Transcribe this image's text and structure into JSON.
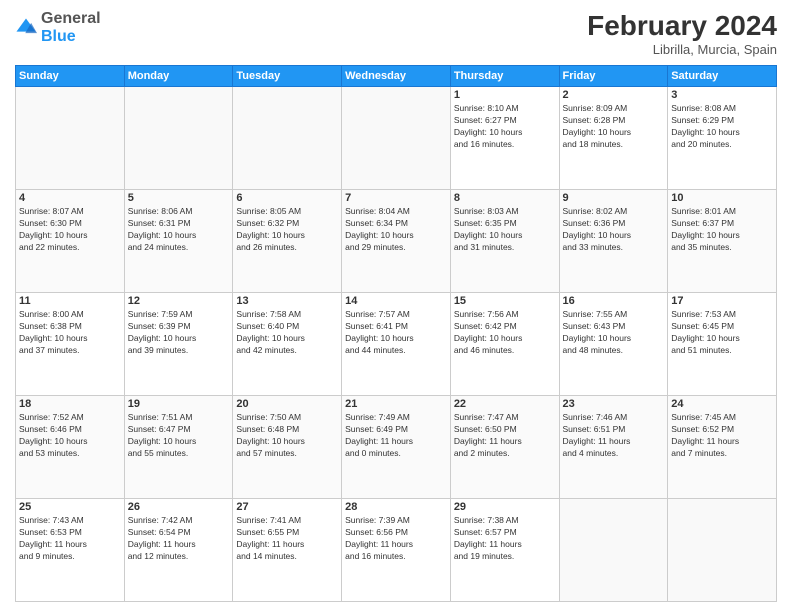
{
  "header": {
    "logo": {
      "general": "General",
      "blue": "Blue"
    },
    "title": "February 2024",
    "location": "Librilla, Murcia, Spain"
  },
  "calendar": {
    "days_of_week": [
      "Sunday",
      "Monday",
      "Tuesday",
      "Wednesday",
      "Thursday",
      "Friday",
      "Saturday"
    ],
    "weeks": [
      [
        {
          "day": "",
          "info": []
        },
        {
          "day": "",
          "info": []
        },
        {
          "day": "",
          "info": []
        },
        {
          "day": "",
          "info": []
        },
        {
          "day": "1",
          "info": [
            "Sunrise: 8:10 AM",
            "Sunset: 6:27 PM",
            "Daylight: 10 hours",
            "and 16 minutes."
          ]
        },
        {
          "day": "2",
          "info": [
            "Sunrise: 8:09 AM",
            "Sunset: 6:28 PM",
            "Daylight: 10 hours",
            "and 18 minutes."
          ]
        },
        {
          "day": "3",
          "info": [
            "Sunrise: 8:08 AM",
            "Sunset: 6:29 PM",
            "Daylight: 10 hours",
            "and 20 minutes."
          ]
        }
      ],
      [
        {
          "day": "4",
          "info": [
            "Sunrise: 8:07 AM",
            "Sunset: 6:30 PM",
            "Daylight: 10 hours",
            "and 22 minutes."
          ]
        },
        {
          "day": "5",
          "info": [
            "Sunrise: 8:06 AM",
            "Sunset: 6:31 PM",
            "Daylight: 10 hours",
            "and 24 minutes."
          ]
        },
        {
          "day": "6",
          "info": [
            "Sunrise: 8:05 AM",
            "Sunset: 6:32 PM",
            "Daylight: 10 hours",
            "and 26 minutes."
          ]
        },
        {
          "day": "7",
          "info": [
            "Sunrise: 8:04 AM",
            "Sunset: 6:34 PM",
            "Daylight: 10 hours",
            "and 29 minutes."
          ]
        },
        {
          "day": "8",
          "info": [
            "Sunrise: 8:03 AM",
            "Sunset: 6:35 PM",
            "Daylight: 10 hours",
            "and 31 minutes."
          ]
        },
        {
          "day": "9",
          "info": [
            "Sunrise: 8:02 AM",
            "Sunset: 6:36 PM",
            "Daylight: 10 hours",
            "and 33 minutes."
          ]
        },
        {
          "day": "10",
          "info": [
            "Sunrise: 8:01 AM",
            "Sunset: 6:37 PM",
            "Daylight: 10 hours",
            "and 35 minutes."
          ]
        }
      ],
      [
        {
          "day": "11",
          "info": [
            "Sunrise: 8:00 AM",
            "Sunset: 6:38 PM",
            "Daylight: 10 hours",
            "and 37 minutes."
          ]
        },
        {
          "day": "12",
          "info": [
            "Sunrise: 7:59 AM",
            "Sunset: 6:39 PM",
            "Daylight: 10 hours",
            "and 39 minutes."
          ]
        },
        {
          "day": "13",
          "info": [
            "Sunrise: 7:58 AM",
            "Sunset: 6:40 PM",
            "Daylight: 10 hours",
            "and 42 minutes."
          ]
        },
        {
          "day": "14",
          "info": [
            "Sunrise: 7:57 AM",
            "Sunset: 6:41 PM",
            "Daylight: 10 hours",
            "and 44 minutes."
          ]
        },
        {
          "day": "15",
          "info": [
            "Sunrise: 7:56 AM",
            "Sunset: 6:42 PM",
            "Daylight: 10 hours",
            "and 46 minutes."
          ]
        },
        {
          "day": "16",
          "info": [
            "Sunrise: 7:55 AM",
            "Sunset: 6:43 PM",
            "Daylight: 10 hours",
            "and 48 minutes."
          ]
        },
        {
          "day": "17",
          "info": [
            "Sunrise: 7:53 AM",
            "Sunset: 6:45 PM",
            "Daylight: 10 hours",
            "and 51 minutes."
          ]
        }
      ],
      [
        {
          "day": "18",
          "info": [
            "Sunrise: 7:52 AM",
            "Sunset: 6:46 PM",
            "Daylight: 10 hours",
            "and 53 minutes."
          ]
        },
        {
          "day": "19",
          "info": [
            "Sunrise: 7:51 AM",
            "Sunset: 6:47 PM",
            "Daylight: 10 hours",
            "and 55 minutes."
          ]
        },
        {
          "day": "20",
          "info": [
            "Sunrise: 7:50 AM",
            "Sunset: 6:48 PM",
            "Daylight: 10 hours",
            "and 57 minutes."
          ]
        },
        {
          "day": "21",
          "info": [
            "Sunrise: 7:49 AM",
            "Sunset: 6:49 PM",
            "Daylight: 11 hours",
            "and 0 minutes."
          ]
        },
        {
          "day": "22",
          "info": [
            "Sunrise: 7:47 AM",
            "Sunset: 6:50 PM",
            "Daylight: 11 hours",
            "and 2 minutes."
          ]
        },
        {
          "day": "23",
          "info": [
            "Sunrise: 7:46 AM",
            "Sunset: 6:51 PM",
            "Daylight: 11 hours",
            "and 4 minutes."
          ]
        },
        {
          "day": "24",
          "info": [
            "Sunrise: 7:45 AM",
            "Sunset: 6:52 PM",
            "Daylight: 11 hours",
            "and 7 minutes."
          ]
        }
      ],
      [
        {
          "day": "25",
          "info": [
            "Sunrise: 7:43 AM",
            "Sunset: 6:53 PM",
            "Daylight: 11 hours",
            "and 9 minutes."
          ]
        },
        {
          "day": "26",
          "info": [
            "Sunrise: 7:42 AM",
            "Sunset: 6:54 PM",
            "Daylight: 11 hours",
            "and 12 minutes."
          ]
        },
        {
          "day": "27",
          "info": [
            "Sunrise: 7:41 AM",
            "Sunset: 6:55 PM",
            "Daylight: 11 hours",
            "and 14 minutes."
          ]
        },
        {
          "day": "28",
          "info": [
            "Sunrise: 7:39 AM",
            "Sunset: 6:56 PM",
            "Daylight: 11 hours",
            "and 16 minutes."
          ]
        },
        {
          "day": "29",
          "info": [
            "Sunrise: 7:38 AM",
            "Sunset: 6:57 PM",
            "Daylight: 11 hours",
            "and 19 minutes."
          ]
        },
        {
          "day": "",
          "info": []
        },
        {
          "day": "",
          "info": []
        }
      ]
    ]
  }
}
